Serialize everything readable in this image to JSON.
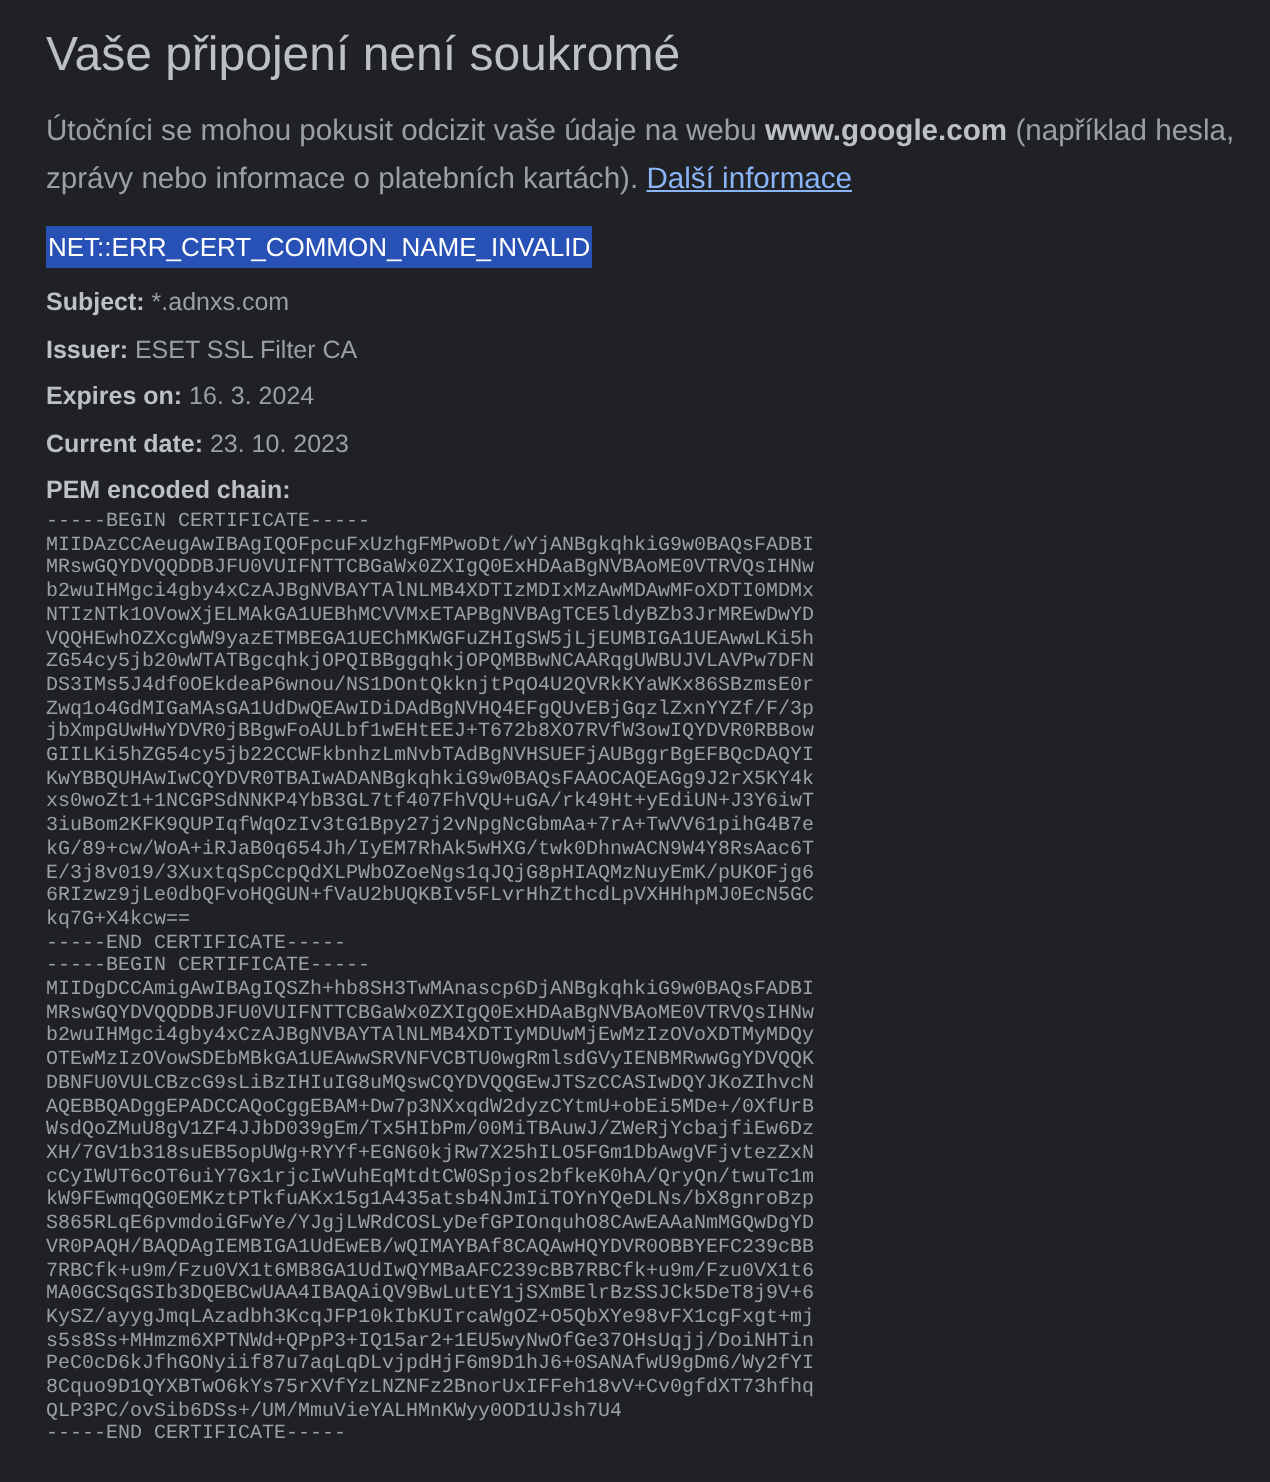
{
  "title": "Vaše připojení není soukromé",
  "description": "Útočníci se mohou pokusit odcizit vaše údaje na webu **www.google.com** (například hesla, zprávy nebo informace o platebních kartách).",
  "learn_more_link": "Další informace",
  "error_code": {
    "text": "NET::ERR_CERT_COMMON_NAME_INVALID",
    "selected": true
  },
  "details": [
    {
      "label": "Subject:",
      "value": "*.adnxs.com"
    },
    {
      "label": "Issuer:",
      "value": "ESET SSL Filter CA"
    },
    {
      "label": "Expires on:",
      "value": "16. 3. 2024"
    },
    {
      "label": "Current date:",
      "value": "23. 10. 2023"
    }
  ],
  "pem_label": "PEM encoded chain:",
  "pem_lines": [
    "-----BEGIN CERTIFICATE-----",
    "MIIDAzCCAeugAwIBAgIQOFpcuFxUzhgFMPwoDt/wYjANBgkqhkiG9w0BAQsFADBI",
    "MRswGQYDVQQDDBJFU0VUIFNTTCBGaWx0ZXIgQ0ExHDAaBgNVBAoME0VTRVQsIHNw",
    "b2wuIHMgci4gby4xCzAJBgNVBAYTAlNLMB4XDTIzMDIxMzAwMDAwMFoXDTI0MDMx",
    "NTIzNTk1OVowXjELMAkGA1UEBhMCVVMxETAPBgNVBAgTCE5ldyBZb3JrMREwDwYD",
    "VQQHEwhOZXcgWW9yazETMBEGA1UEChMKWGFuZHIgSW5jLjEUMBIGA1UEAwwLKi5h",
    "ZG54cy5jb20wWTATBgcqhkjOPQIBBggqhkjOPQMBBwNCAARqgUWBUJVLAVPw7DFN",
    "DS3IMs5J4df0OEkdeaP6wnou/NS1DOntQkknjtPqO4U2QVRkKYaWKx86SBzmsE0r",
    "Zwq1o4GdMIGaMAsGA1UdDwQEAwIDiDAdBgNVHQ4EFgQUvEBjGqzlZxnYYZf/F/3p",
    "jbXmpGUwHwYDVR0jBBgwFoAULbf1wEHtEEJ+T672b8XO7RVfW3owIQYDVR0RBBow",
    "GIILKi5hZG54cy5jb22CCWFkbnhzLmNvbTAdBgNVHSUEFjAUBggrBgEFBQcDAQYI",
    "KwYBBQUHAwIwCQYDVR0TBAIwADANBgkqhkiG9w0BAQsFAAOCAQEAGg9J2rX5KY4k",
    "xs0woZt1+1NCGPSdNNKP4YbB3GL7tf407FhVQU+uGA/rk49Ht+yEdiUN+J3Y6iwT",
    "3iuBom2KFK9QUPIqfWqOzIv3tG1Bpy27j2vNpgNcGbmAa+7rA+TwVV61pihG4B7e",
    "kG/89+cw/WoA+iRJaB0q654Jh/IyEM7RhAk5wHXG/twk0DhnwACN9W4Y8RsAac6T",
    "E/3j8v019/3XuxtqSpCcpQdXLPWbOZoeNgs1qJQjG8pHIAQMzNuyEmK/pUKOFjg6",
    "6RIzwz9jLe0dbQFvoHQGUN+fVaU2bUQKBIv5FLvrHhZthcdLpVXHHhpMJ0EcN5GC",
    "kq7G+X4kcw==",
    "-----END CERTIFICATE-----",
    "-----BEGIN CERTIFICATE-----",
    "MIIDgDCCAmigAwIBAgIQSZh+hb8SH3TwMAnascp6DjANBgkqhkiG9w0BAQsFADBI",
    "MRswGQYDVQQDDBJFU0VUIFNTTCBGaWx0ZXIgQ0ExHDAaBgNVBAoME0VTRVQsIHNw",
    "b2wuIHMgci4gby4xCzAJBgNVBAYTAlNLMB4XDTIyMDUwMjEwMzIzOVoXDTMyMDQy",
    "OTEwMzIzOVowSDEbMBkGA1UEAwwSRVNFVCBTU0wgRmlsdGVyIENBMRwwGgYDVQQK",
    "DBNFU0VULCBzcG9sLiBzIHIuIG8uMQswCQYDVQQGEwJTSzCCASIwDQYJKoZIhvcN",
    "AQEBBQADggEPADCCAQoCggEBAM+Dw7p3NXxqdW2dyzCYtmU+obEi5MDe+/0XfUrB",
    "WsdQoZMuU8gV1ZF4JJbD039gEm/Tx5HIbPm/00MiTBAuwJ/ZWeRjYcbajfiEw6Dz",
    "XH/7GV1b318suEB5opUWg+RYYf+EGN60kjRw7X25hILO5FGm1DbAwgVFjvtezZxN",
    "cCyIWUT6cOT6uiY7Gx1rjcIwVuhEqMtdtCW0Spjos2bfkeK0hA/QryQn/twuTc1m",
    "kW9FEwmqQG0EMKztPTkfuAKx15g1A435atsb4NJmIiTOYnYQeDLNs/bX8gnroBzp",
    "S865RLqE6pvmdoiGFwYe/YJgjLWRdCOSLyDefGPIOnquhO8CAwEAAaNmMGQwDgYD",
    "VR0PAQH/BAQDAgIEMBIGA1UdEwEB/wQIMAYBAf8CAQAwHQYDVR0OBBYEFC239cBB",
    "7RBCfk+u9m/Fzu0VX1t6MB8GA1UdIwQYMBaAFC239cBB7RBCfk+u9m/Fzu0VX1t6",
    "MA0GCSqGSIb3DQEBCwUAA4IBAQAiQV9BwLutEY1jSXmBElrBzSSJCk5DeT8j9V+6",
    "KySZ/ayygJmqLAzadbh3KcqJFP10kIbKUIrcaWgOZ+O5QbXYe98vFX1cgFxgt+mj",
    "s5s8Ss+MHmzm6XPTNWd+QPpP3+IQ15ar2+1EU5wyNwOfGe37OHsUqjj/DoiNHTin",
    "PeC0cD6kJfhGONyiif87u7aqLqDLvjpdHjF6m9D1hJ6+0SANAfwU9gDm6/Wy2fYI",
    "8Cquo9D1QYXBTwO6kYs75rXVfYzLNZNFz2BnorUxIFFeh18vV+Cv0gfdXT73hfhq",
    "QLP3PC/ovSib6DSs+/UM/MmuVieYALHMnKWyy0OD1UJsh7U4",
    "-----END CERTIFICATE-----"
  ]
}
